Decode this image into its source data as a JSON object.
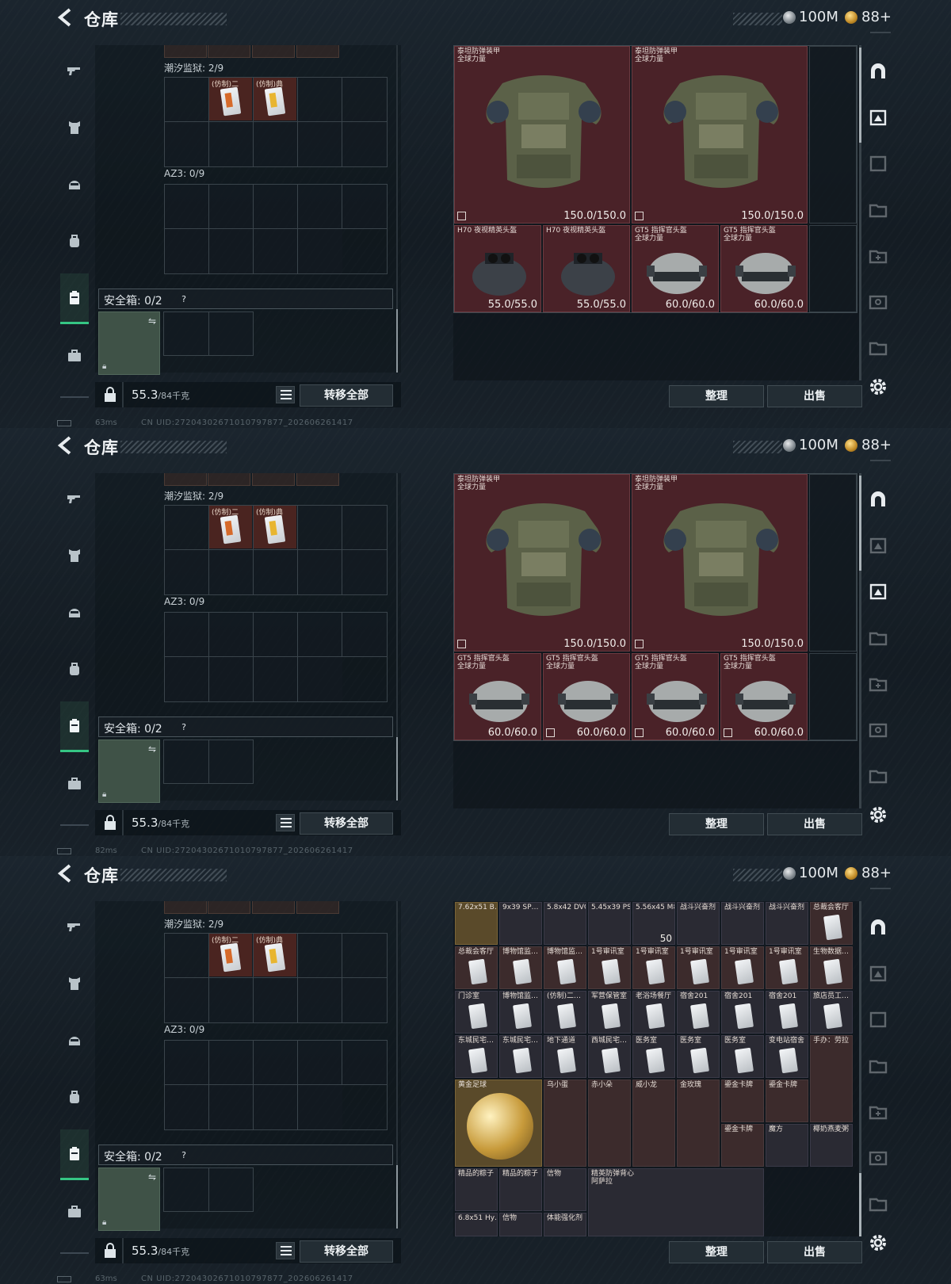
{
  "screens": [
    {
      "ping": "63ms"
    },
    {
      "ping": "82ms"
    },
    {
      "ping": "63ms"
    }
  ],
  "header": {
    "title": "仓库",
    "currency_silver": "100M",
    "currency_gold": "88+"
  },
  "left": {
    "tidal_label": "潮汐监狱: 2/9",
    "az3_label": "AZ3: 0/9",
    "safebox_label": "安全箱: 0/2",
    "safebox_help": "?",
    "key1_label": "(仿制)二",
    "key2_label": "(仿制)典",
    "weight_value": "55.3",
    "weight_max": "/84千克",
    "transfer_all": "转移全部"
  },
  "right": {
    "armor_name": "泰坦防弹装甲\n全球力量",
    "armor_dur": "150.0/150.0",
    "h70_name": "H70 夜视精英头盔",
    "h70_dur": "55.0/55.0",
    "gt5_name": "GT5 指挥官头盔\n全球力量",
    "gt5_dur": "60.0/60.0",
    "organize": "整理",
    "sell": "出售"
  },
  "status": {
    "uid": "CN UID:272043026710107978​77_202606261417"
  },
  "misc": {
    "row1": [
      "7.62x51 B…",
      "9x39 SP…",
      "5.8x42 DVC…",
      "5.45x39 PS…",
      "5.56x45 M855",
      "战斗兴奋剂",
      "战斗兴奋剂",
      "战斗兴奋剂",
      "总裁会客厅"
    ],
    "row2": [
      "总裁会客厅",
      "博物馆监…",
      "博物馆监…",
      "1号审讯室",
      "1号审讯室",
      "1号审讯室",
      "1号审讯室",
      "1号审讯室",
      "生物数据…"
    ],
    "row3": [
      "门诊室",
      "博物馆监…",
      "(仿制)二…",
      "军营保管室",
      "老浴场餐厅",
      "宿舍201",
      "宿舍201",
      "宿舍201",
      "旅店员工…"
    ],
    "row4": [
      "东城民宅…",
      "东城民宅…",
      "地下通道",
      "西城民宅…",
      "医务室",
      "医务室",
      "医务室",
      "变电站宿舍",
      "手办：劳拉"
    ],
    "row5": [
      "黄金足球",
      "乌小蛋",
      "赤小朵",
      "威小龙",
      "金玫瑰",
      "鎏金卡牌",
      "鎏金卡牌"
    ],
    "row6": [
      "鎏金卡牌",
      "魔方",
      "椰奶燕麦粥"
    ],
    "row7": [
      "精品的粽子",
      "精品的粽子",
      "信物",
      "精英防弹背心\n阿萨拉"
    ],
    "row8": [
      "6.8x51 Hy…",
      "信物",
      "体能强化剂"
    ],
    "ammo_qty": "50"
  },
  "colors": {
    "accent": "#35c684",
    "item_red": "#4a2228"
  }
}
